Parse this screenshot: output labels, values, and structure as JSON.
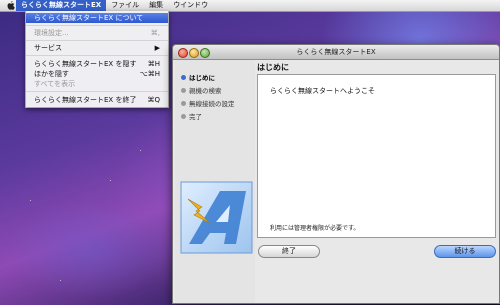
{
  "menubar": {
    "app_name": "らくらく無線スタートEX",
    "items": [
      "ファイル",
      "編集",
      "ウインドウ"
    ]
  },
  "app_menu": {
    "about": "らくらく無線スタートEX について",
    "preferences": "環境設定...",
    "preferences_shortcut": "⌘,",
    "services": "サービス",
    "services_arrow": "▶",
    "hide": "らくらく無線スタートEX を隠す",
    "hide_shortcut": "⌘H",
    "hide_others": "ほかを隠す",
    "hide_others_shortcut": "⌥⌘H",
    "show_all": "すべてを表示",
    "quit": "らくらく無線スタートEX を終了",
    "quit_shortcut": "⌘Q"
  },
  "window": {
    "title": "らくらく無線スタートEX",
    "steps": [
      "はじめに",
      "親機の検索",
      "無線接続の設定",
      "完了"
    ],
    "current_step": "はじめに",
    "heading": "はじめに",
    "welcome": "らくらく無線スタートへようこそ",
    "note": "利用には管理者権限が必要です。",
    "quit_button": "終了",
    "continue_button": "続ける"
  },
  "colors": {
    "accent": "#3560c8",
    "menu_highlight": "#2d58d0"
  }
}
